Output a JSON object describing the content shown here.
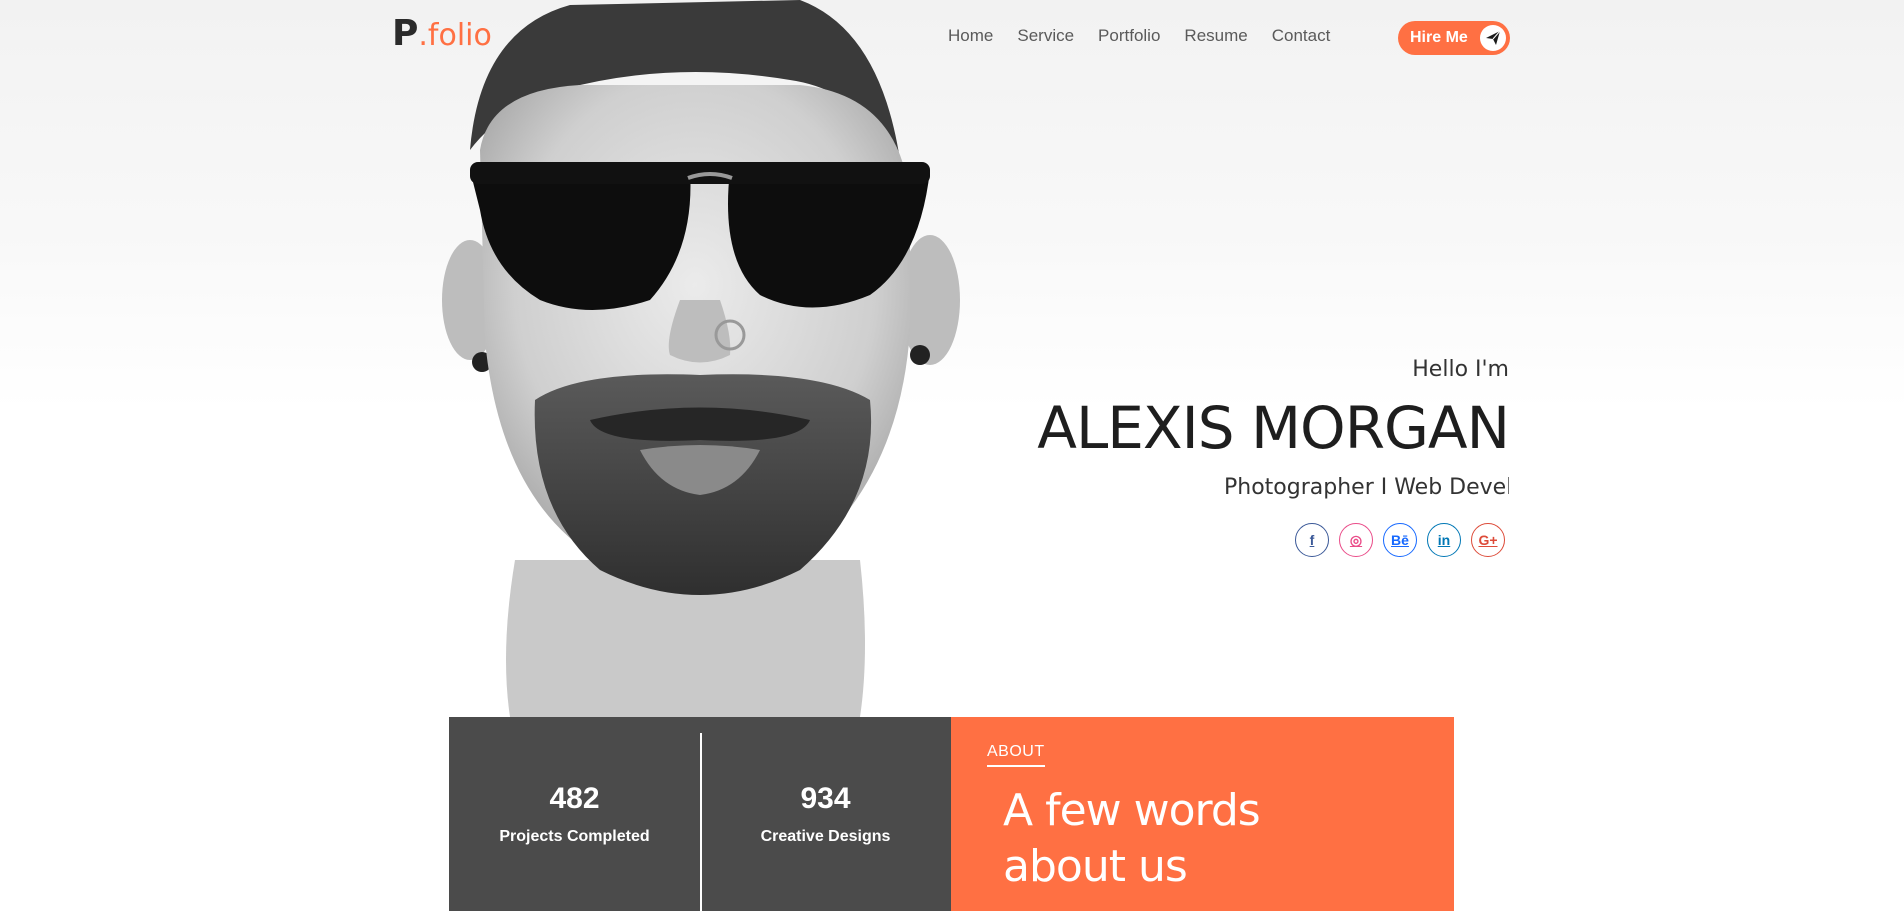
{
  "header": {
    "logo": {
      "main": "P",
      "accent": ".folio"
    },
    "nav": [
      "Home",
      "Service",
      "Portfolio",
      "Resume",
      "Contact"
    ],
    "hire_label": "Hire Me",
    "hire_icon": "paper-plane-icon"
  },
  "hero": {
    "greeting": "Hello I'm",
    "name": "ALEXIS MORGAN",
    "role": "Photographer I Web Developer",
    "socials": [
      {
        "icon": "facebook-icon",
        "glyph": "f",
        "color": "#3b5998"
      },
      {
        "icon": "dribbble-icon",
        "glyph": "◎",
        "color": "#ea4c89"
      },
      {
        "icon": "behance-icon",
        "glyph": "Bē",
        "color": "#1769ff"
      },
      {
        "icon": "linkedin-icon",
        "glyph": "in",
        "color": "#0077b5"
      },
      {
        "icon": "google-plus-icon",
        "glyph": "G+",
        "color": "#dd4b39"
      }
    ]
  },
  "stats": [
    {
      "value": "482",
      "label": "Projects Completed"
    },
    {
      "value": "934",
      "label": "Creative Designs"
    }
  ],
  "about": {
    "label": "ABOUT",
    "heading_line1": "A few words",
    "heading_line2": "about us"
  },
  "colors": {
    "accent": "#ff7043",
    "dark_band": "#4b4b4b"
  }
}
